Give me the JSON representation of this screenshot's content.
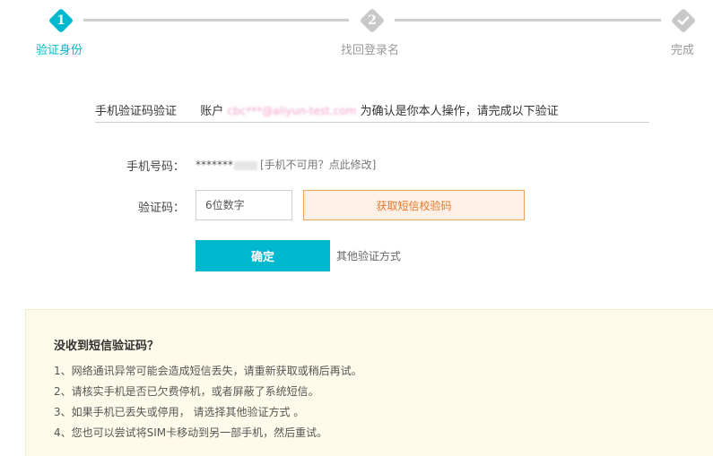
{
  "colors": {
    "accent": "#00b7d0",
    "inactive": "#c8c8c8",
    "sms_text": "#e8772a",
    "sms_border": "#f0a25a",
    "help_bg": "#fffbea"
  },
  "steps": [
    {
      "num": "1",
      "label": "验证身份",
      "state": "active"
    },
    {
      "num": "2",
      "label": "找回登录名",
      "state": "pending"
    },
    {
      "num": "",
      "label": "完成",
      "state": "pending",
      "icon": "check-icon"
    }
  ],
  "verify": {
    "method": "手机验证码验证",
    "account_prefix": "账户",
    "account_masked": "cbc***@aliyun-test.com",
    "account_suffix": "为确认是你本人操作，请完成以下验证"
  },
  "form": {
    "phone_label": "手机号码：",
    "phone_value": "*******",
    "phone_tail": "",
    "phone_link": "[手机不可用？点此修改]",
    "code_label": "验证码：",
    "code_placeholder": "6位数字",
    "sms_button": "获取短信校验码",
    "confirm_button": "确定",
    "other_method": "其他验证方式"
  },
  "help": {
    "title": "没收到短信验证码？",
    "items": [
      "1、网络通讯异常可能会造成短信丢失，请重新获取或稍后再试。",
      "2、请核实手机是否已欠费停机，或者屏蔽了系统短信。",
      "3、如果手机已丢失或停用， 请选择其他验证方式 。",
      "4、您也可以尝试将SIM卡移动到另一部手机，然后重试。"
    ]
  }
}
